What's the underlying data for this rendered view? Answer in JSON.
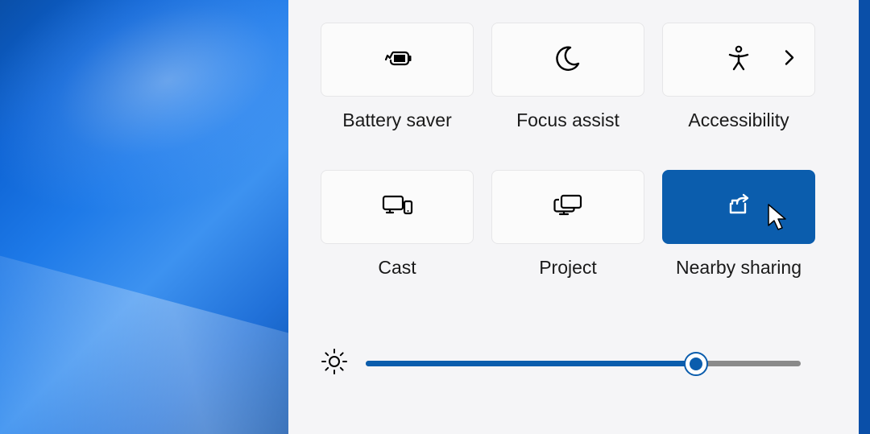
{
  "panel": {
    "tiles": [
      {
        "id": "battery-saver",
        "label": "Battery saver",
        "icon": "battery-saver",
        "active": false,
        "expandable": false
      },
      {
        "id": "focus-assist",
        "label": "Focus assist",
        "icon": "moon",
        "active": false,
        "expandable": false
      },
      {
        "id": "accessibility",
        "label": "Accessibility",
        "icon": "accessibility",
        "active": false,
        "expandable": true
      },
      {
        "id": "cast",
        "label": "Cast",
        "icon": "cast",
        "active": false,
        "expandable": false
      },
      {
        "id": "project",
        "label": "Project",
        "icon": "project",
        "active": false,
        "expandable": false
      },
      {
        "id": "nearby-sharing",
        "label": "Nearby sharing",
        "icon": "share",
        "active": true,
        "expandable": false
      }
    ],
    "brightness": {
      "value": 76,
      "min": 0,
      "max": 100
    }
  },
  "colors": {
    "accent": "#0b5dad",
    "panel_bg": "#f5f5f7",
    "tile_bg": "#fbfbfb",
    "tile_border": "#e6e6e8"
  }
}
